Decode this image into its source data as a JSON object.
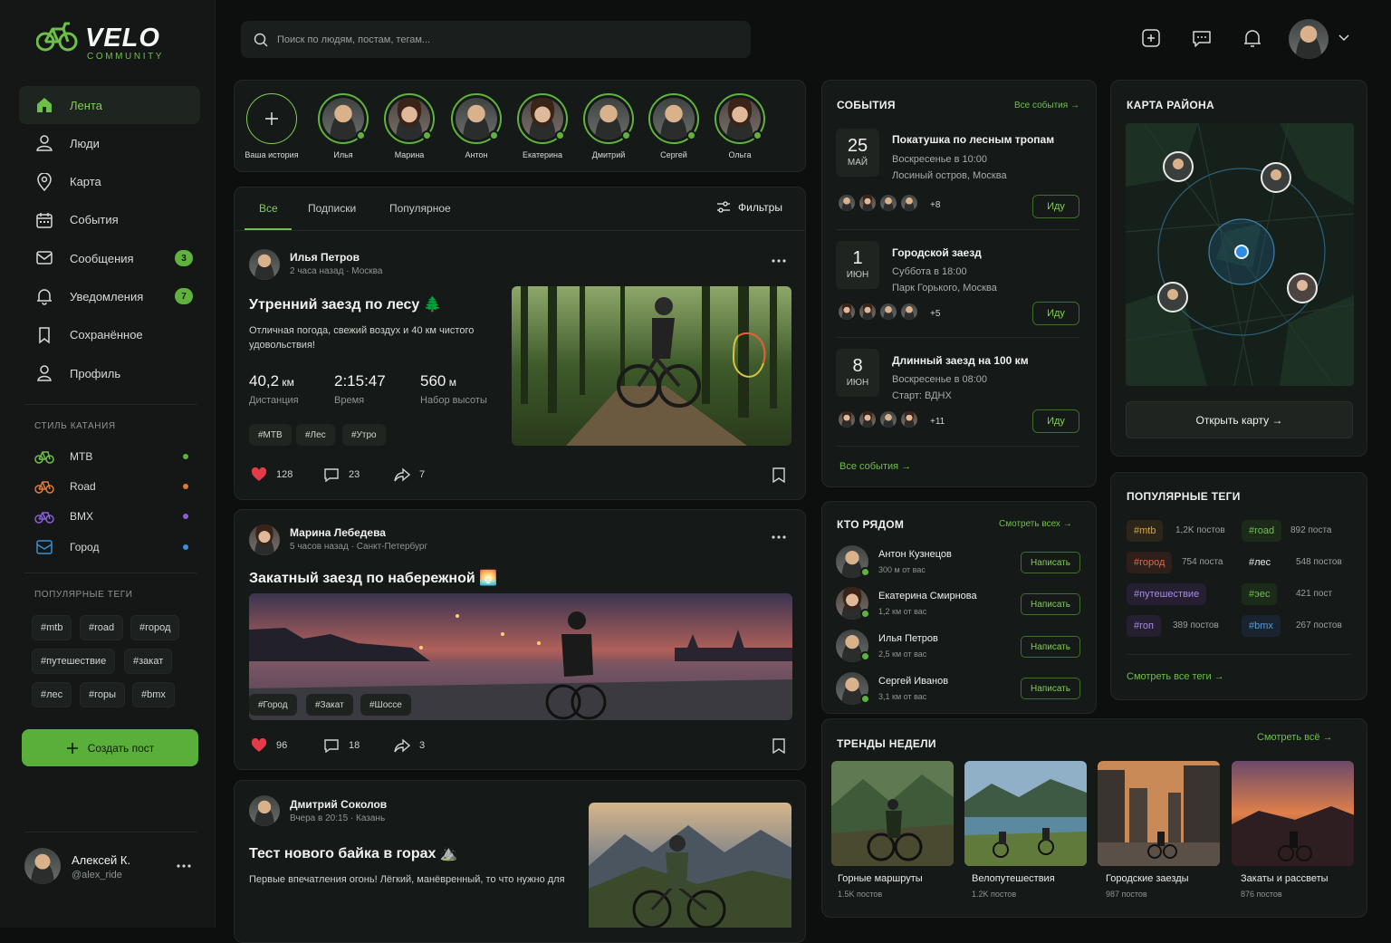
{
  "brand": {
    "title": "VELO",
    "subtitle": "COMMUNITY"
  },
  "nav": [
    {
      "label": "Лента",
      "icon": "home-icon",
      "active": true
    },
    {
      "label": "Люди",
      "icon": "person-icon"
    },
    {
      "label": "Карта",
      "icon": "map-pin-icon"
    },
    {
      "label": "События",
      "icon": "calendar-icon"
    },
    {
      "label": "Сообщения",
      "icon": "message-icon",
      "badge": "3"
    },
    {
      "label": "Уведомления",
      "icon": "bell-icon",
      "badge": "7"
    },
    {
      "label": "Сохранённое",
      "icon": "bookmark-icon"
    },
    {
      "label": "Профиль",
      "icon": "profile-icon"
    }
  ],
  "riding_style": {
    "title": "СТИЛЬ КАТАНИЯ",
    "items": [
      {
        "label": "MTB",
        "color": "#5fb33d"
      },
      {
        "label": "Road",
        "color": "#e07a3a"
      },
      {
        "label": "BMX",
        "color": "#8a5fd6"
      },
      {
        "label": "Город",
        "color": "#3b8fd6"
      }
    ]
  },
  "sidebar_tags": {
    "title": "ПОПУЛЯРНЫЕ ТЕГИ",
    "items": [
      "#mtb",
      "#road",
      "#город",
      "#путешествие",
      "#закат",
      "#лес",
      "#горы",
      "#bmx"
    ]
  },
  "create_post": "Создать пост",
  "current_user": {
    "name": "Алексей К.",
    "handle": "@alex_ride"
  },
  "search": {
    "placeholder": "Поиск по людям, постам, тегам..."
  },
  "stories": [
    {
      "label": "Ваша история"
    },
    {
      "label": "Илья",
      "gender": "m"
    },
    {
      "label": "Марина",
      "gender": "f"
    },
    {
      "label": "Антон",
      "gender": "m"
    },
    {
      "label": "Екатерина",
      "gender": "f"
    },
    {
      "label": "Дмитрий",
      "gender": "m"
    },
    {
      "label": "Сергей",
      "gender": "m"
    },
    {
      "label": "Ольга",
      "gender": "f"
    }
  ],
  "feed_tabs": [
    "Все",
    "Подписки",
    "Популярное"
  ],
  "filters": "Фильтры",
  "posts": [
    {
      "author": "Илья Петров",
      "meta": "2 часа назад · Москва",
      "title": "Утренний заезд по лесу 🌲",
      "text": "Отличная погода, свежий воздух и 40 км чистого удовольствия!",
      "stats": [
        {
          "value": "40,2",
          "unit": " км",
          "label": "Дистанция"
        },
        {
          "value": "2:15:47",
          "unit": "",
          "label": "Время"
        },
        {
          "value": "560",
          "unit": " м",
          "label": "Набор высоты"
        }
      ],
      "tags": [
        "#MTB",
        "#Лес",
        "#Утро"
      ],
      "likes": "128",
      "comments": "23",
      "shares": "7"
    },
    {
      "author": "Марина Лебедева",
      "meta": "5 часов назад · Санкт-Петербург",
      "title": "Закатный заезд по набережной 🌅",
      "tags": [
        "#Город",
        "#Закат",
        "#Шоссе"
      ],
      "likes": "96",
      "comments": "18",
      "shares": "3"
    },
    {
      "author": "Дмитрий Соколов",
      "meta": "Вчера в 20:15 · Казань",
      "title": "Тест нового байка в горах ⛰️",
      "text": "Первые впечатления огонь! Лёгкий, манёвренный, то что нужно для"
    }
  ],
  "events": {
    "title": "СОБЫТИЯ",
    "all_link": "Все события →",
    "footer_link": "Все события →",
    "go_label": "Иду",
    "items": [
      {
        "day": "25",
        "month": "МАЙ",
        "title": "Покатушка по лесным тропам",
        "when": "Воскресенье в 10:00",
        "where": "Лосиный остров, Москва",
        "more": "+8"
      },
      {
        "day": "1",
        "month": "ИЮН",
        "title": "Городской заезд",
        "when": "Суббота в 18:00",
        "where": "Парк Горького, Москва",
        "more": "+5"
      },
      {
        "day": "8",
        "month": "ИЮН",
        "title": "Длинный заезд на 100 км",
        "when": "Воскресенье в 08:00",
        "where": "Старт: ВДНХ",
        "more": "+11"
      }
    ]
  },
  "map": {
    "title": "КАРТА РАЙОНА",
    "button": "Открыть карту →"
  },
  "nearby": {
    "title": "КТО РЯДОМ",
    "all_link": "Смотреть всех →",
    "write_label": "Написать",
    "items": [
      {
        "name": "Антон Кузнецов",
        "dist": "300 м от вас",
        "gender": "m"
      },
      {
        "name": "Екатерина Смирнова",
        "dist": "1,2 км от вас",
        "gender": "f"
      },
      {
        "name": "Илья Петров",
        "dist": "2,5 км от вас",
        "gender": "m"
      },
      {
        "name": "Сергей Иванов",
        "dist": "3,1 км от вас",
        "gender": "m"
      }
    ]
  },
  "popular_tags": {
    "title": "ПОПУЛЯРНЫЕ ТЕГИ",
    "all_link": "Смотреть все теги →",
    "items": [
      {
        "tag": "#mtb",
        "count": "1,2K постов",
        "color": "#d8a43a"
      },
      {
        "tag": "#road",
        "count": "892 поста",
        "color": "#6cc04a"
      },
      {
        "tag": "#город",
        "count": "754 поста",
        "color": "#e0664a"
      },
      {
        "tag": "#лес",
        "count": "548 постов",
        "color": "#e9ecea"
      },
      {
        "tag": "#путешествие",
        "count": "",
        "color": "#a88ae6"
      },
      {
        "tag": "#эес",
        "count": "421 пост",
        "color": "#6cc04a"
      },
      {
        "tag": "#гоп",
        "count": "389 постов",
        "color": "#a88ae6"
      },
      {
        "tag": "#bmx",
        "count": "267 постов",
        "color": "#5b9ad8"
      }
    ]
  },
  "trends": {
    "title": "ТРЕНДЫ НЕДЕЛИ",
    "all_link": "Смотреть всё →",
    "items": [
      {
        "name": "Горные маршруты",
        "count": "1.5K постов"
      },
      {
        "name": "Велопутешествия",
        "count": "1.2K постов"
      },
      {
        "name": "Городские заезды",
        "count": "987 постов"
      },
      {
        "name": "Закаты и рассветы",
        "count": "876 постов"
      }
    ]
  },
  "colors": {
    "accent": "#5fb33d",
    "bg": "#0d0f0e",
    "panel": "#151917"
  }
}
